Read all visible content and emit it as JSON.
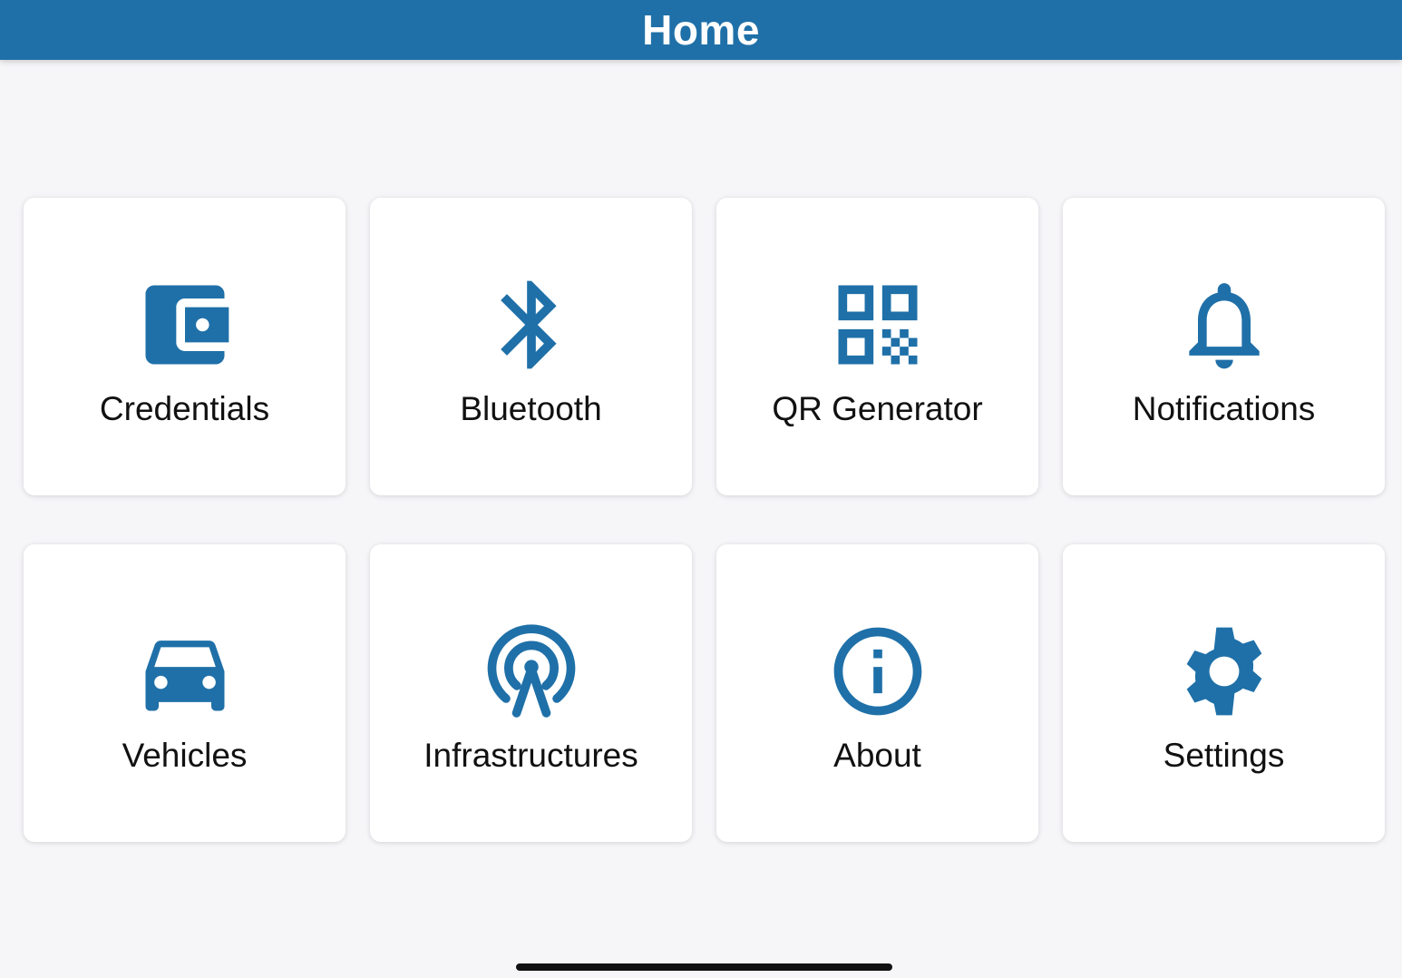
{
  "header": {
    "title": "Home"
  },
  "colors": {
    "accent": "#1f70a8",
    "background": "#f6f5f8",
    "tile": "#ffffff"
  },
  "tiles": [
    {
      "label": "Credentials",
      "icon": "wallet-icon"
    },
    {
      "label": "Bluetooth",
      "icon": "bluetooth-icon"
    },
    {
      "label": "QR Generator",
      "icon": "qr-code-icon"
    },
    {
      "label": "Notifications",
      "icon": "bell-icon"
    },
    {
      "label": "Vehicles",
      "icon": "car-icon"
    },
    {
      "label": "Infrastructures",
      "icon": "broadcast-tower-icon"
    },
    {
      "label": "About",
      "icon": "info-icon"
    },
    {
      "label": "Settings",
      "icon": "gear-icon"
    }
  ]
}
